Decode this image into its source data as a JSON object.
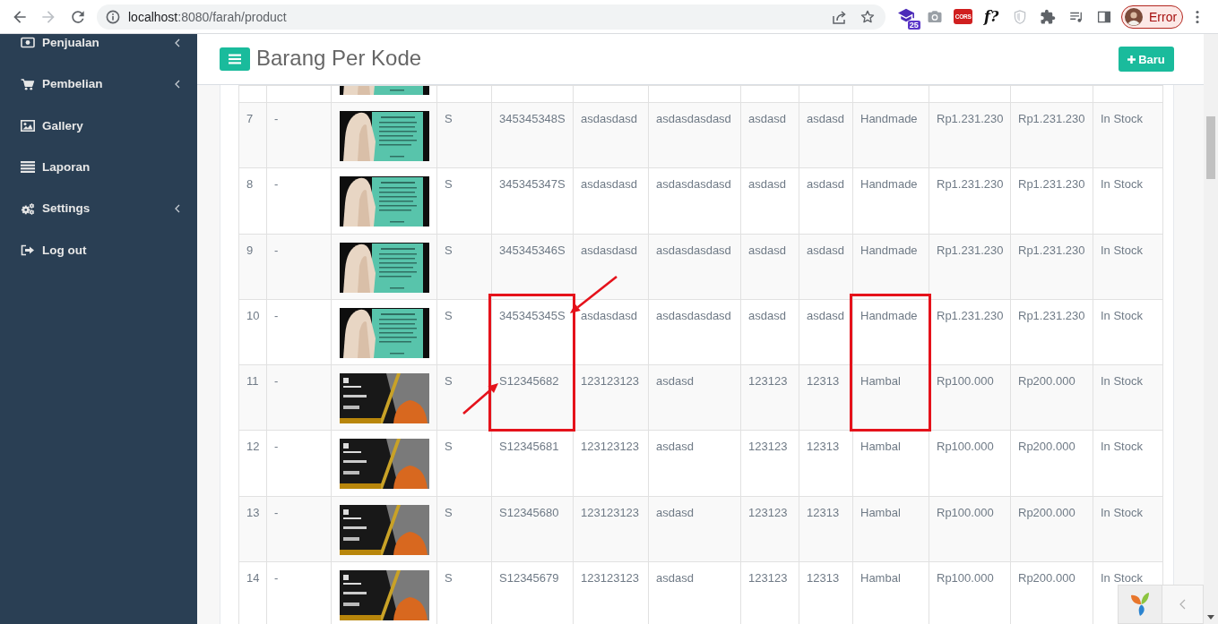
{
  "browser": {
    "back": {
      "disabled": false
    },
    "forward": {
      "disabled": true
    },
    "url": {
      "host": "localhost",
      "path": ":8080/farah/product"
    },
    "extensions": {
      "badge": "25",
      "tile_label": "CORS",
      "glyph_label": "f?"
    },
    "profile": {
      "label": "Error"
    }
  },
  "sidebar": {
    "items": [
      {
        "label": "Penjualan",
        "has_submenu": true
      },
      {
        "label": "Pembelian",
        "has_submenu": true
      },
      {
        "label": "Gallery",
        "has_submenu": false
      },
      {
        "label": "Laporan",
        "has_submenu": false
      },
      {
        "label": "Settings",
        "has_submenu": true
      },
      {
        "label": "Log out",
        "has_submenu": false
      }
    ]
  },
  "header": {
    "title": "Barang Per Kode",
    "new_button": "Baru"
  },
  "table": {
    "columns": [
      {
        "boxed": false
      },
      {
        "boxed": false
      },
      {
        "boxed": false
      },
      {
        "boxed": false
      },
      {
        "boxed": true
      },
      {
        "boxed": false
      },
      {
        "boxed": false
      },
      {
        "boxed": false
      },
      {
        "boxed": false
      },
      {
        "boxed": true
      },
      {
        "boxed": false
      },
      {
        "boxed": false
      },
      {
        "boxed": false
      }
    ],
    "clipped_top_row": {
      "photo": {
        "kind": "teal-card"
      }
    },
    "rows": [
      {
        "photo": {
          "kind": "teal-card"
        },
        "boxed": false,
        "cells": [
          "7",
          "-",
          "S",
          "345345348S",
          "asdasdasd",
          "asdasdasdasd",
          "asdasd",
          "asdasd",
          "Handmade",
          "Rp1.231.230",
          "Rp1.231.230",
          "In Stock"
        ]
      },
      {
        "photo": {
          "kind": "teal-card"
        },
        "boxed": false,
        "cells": [
          "8",
          "-",
          "S",
          "345345347S",
          "asdasdasd",
          "asdasdasdasd",
          "asdasd",
          "asdasd",
          "Handmade",
          "Rp1.231.230",
          "Rp1.231.230",
          "In Stock"
        ]
      },
      {
        "photo": {
          "kind": "teal-card"
        },
        "boxed": false,
        "cells": [
          "9",
          "-",
          "S",
          "345345346S",
          "asdasdasd",
          "asdasdasdasd",
          "asdasd",
          "asdasd",
          "Handmade",
          "Rp1.231.230",
          "Rp1.231.230",
          "In Stock"
        ]
      },
      {
        "photo": {
          "kind": "teal-card"
        },
        "boxed": true,
        "arrow": {
          "kind": "from-upper-right"
        },
        "cells": [
          "10",
          "-",
          "S",
          "345345345S",
          "asdasdasd",
          "asdasdasdasd",
          "asdasd",
          "asdasd",
          "Handmade",
          "Rp1.231.230",
          "Rp1.231.230",
          "In Stock"
        ]
      },
      {
        "photo": {
          "kind": "dark-banner"
        },
        "boxed": true,
        "arrow": {
          "kind": "from-lower-left"
        },
        "cells": [
          "11",
          "-",
          "S",
          "S12345682",
          "123123123",
          "asdasd",
          "123123",
          "12313",
          "Hambal",
          "Rp100.000",
          "Rp200.000",
          "In Stock"
        ]
      },
      {
        "photo": {
          "kind": "dark-banner"
        },
        "boxed": false,
        "cells": [
          "12",
          "-",
          "S",
          "S12345681",
          "123123123",
          "asdasd",
          "123123",
          "12313",
          "Hambal",
          "Rp100.000",
          "Rp200.000",
          "In Stock"
        ]
      },
      {
        "photo": {
          "kind": "dark-banner"
        },
        "boxed": false,
        "cells": [
          "13",
          "-",
          "S",
          "S12345680",
          "123123123",
          "asdasd",
          "123123",
          "12313",
          "Hambal",
          "Rp100.000",
          "Rp200.000",
          "In Stock"
        ]
      },
      {
        "photo": {
          "kind": "dark-banner"
        },
        "boxed": false,
        "cells": [
          "14",
          "-",
          "S",
          "S12345679",
          "123123123",
          "asdasd",
          "123123",
          "12313",
          "Hambal",
          "Rp100.000",
          "Rp200.000",
          "In Stock"
        ]
      }
    ]
  }
}
